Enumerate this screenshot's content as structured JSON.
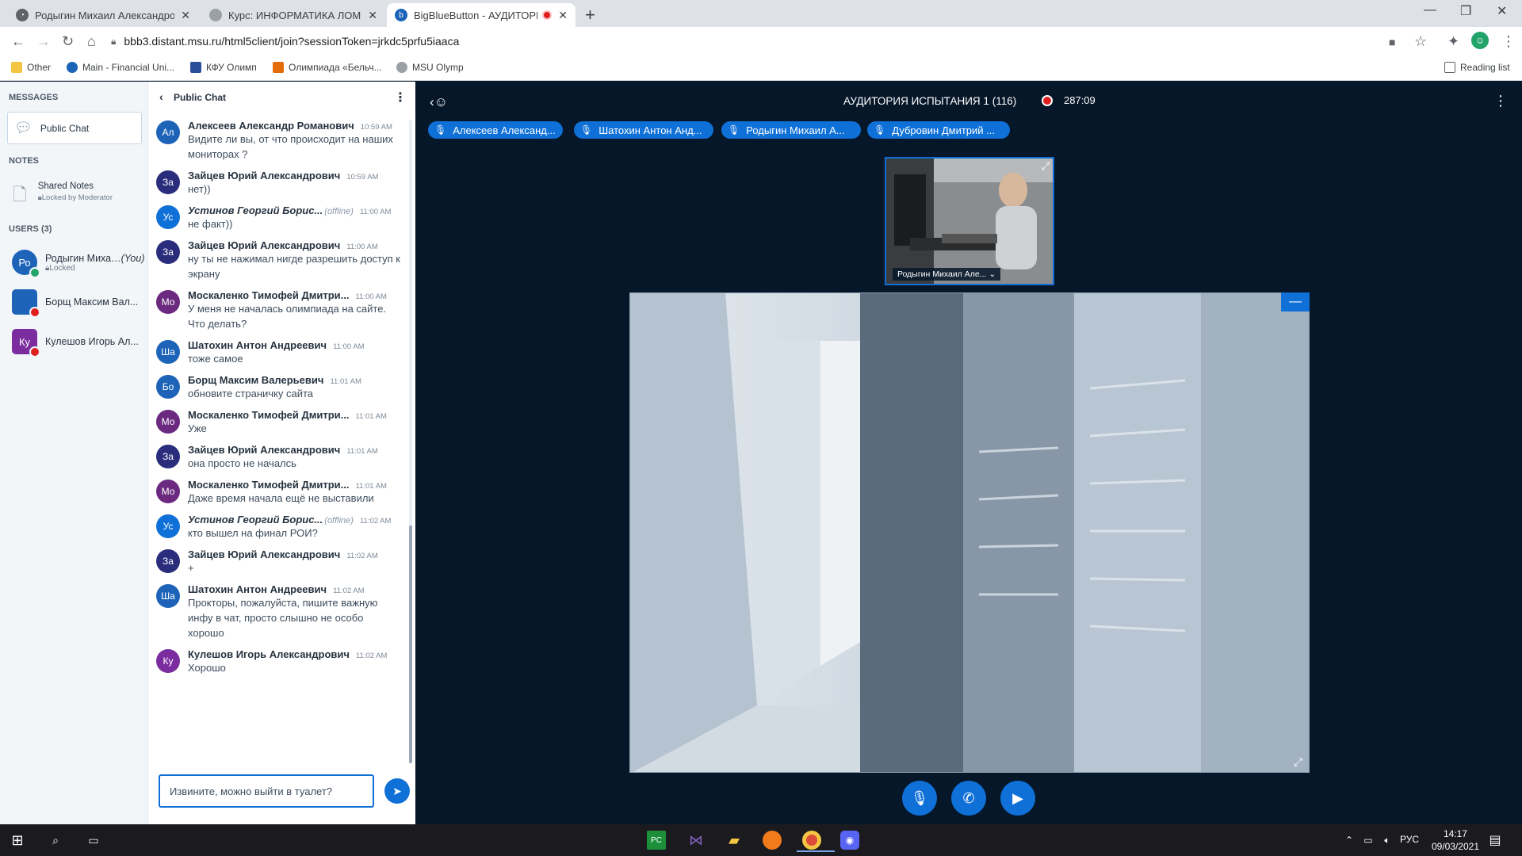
{
  "browser": {
    "tabs": [
      {
        "title": "Родыгин Михаил Александрови",
        "active": false
      },
      {
        "title": "Курс: ИНФОРМАТИКА ЛОМОНО",
        "active": false
      },
      {
        "title": "BigBlueButton - АУДИТОРИ",
        "active": true
      }
    ],
    "url": "bbb3.distant.msu.ru/html5client/join?sessionToken=jrkdc5prfu5iaaca",
    "bookmarks": [
      {
        "label": "Other"
      },
      {
        "label": "Main - Financial Uni..."
      },
      {
        "label": "КФУ Олимп"
      },
      {
        "label": "Олимпиада «Бельч..."
      },
      {
        "label": "MSU Olymp"
      }
    ],
    "reading_list": "Reading list"
  },
  "sidebar": {
    "messages_title": "MESSAGES",
    "public_chat": "Public Chat",
    "notes_title": "NOTES",
    "shared_notes": "Shared Notes",
    "shared_notes_sub": "Locked by Moderator",
    "users_title": "USERS (3)",
    "users": [
      {
        "initials": "Ро",
        "name": "Родыгин Миха…",
        "you": "(You)",
        "sub": "Locked",
        "color": "#1d63b8"
      },
      {
        "initials": "",
        "name": "Борщ Максим Вал...",
        "sub": "",
        "color": "#1d63b8"
      },
      {
        "initials": "Ку",
        "name": "Кулешов Игорь Ал...",
        "sub": "",
        "color": "#7b2c9f"
      }
    ]
  },
  "chat": {
    "title": "Public Chat",
    "messages": [
      {
        "initials": "Ал",
        "color": "#1d63b8",
        "author": "Алексеев Александр Романович",
        "offline": "",
        "time": "10:59 AM",
        "text": "Видите ли вы, от что происходит на наших мониторах ?"
      },
      {
        "initials": "За",
        "color": "#2a2d7c",
        "author": "Зайцев Юрий Александрович",
        "offline": "",
        "time": "10:59 AM",
        "text": "нет))"
      },
      {
        "initials": "Ус",
        "color": "#0f70d7",
        "author": "Устинов Георгий Борис...",
        "offline": "(offline)",
        "time": "11:00 AM",
        "text": "не факт))"
      },
      {
        "initials": "За",
        "color": "#2a2d7c",
        "author": "Зайцев Юрий Александрович",
        "offline": "",
        "time": "11:00 AM",
        "text": "ну ты не нажимал нигде разрешить доступ к экрану"
      },
      {
        "initials": "Мо",
        "color": "#6b2a7f",
        "author": "Москаленко Тимофей Дмитри...",
        "offline": "",
        "time": "11:00 AM",
        "text": "У меня не началась олимпиада на сайте. Что делать?"
      },
      {
        "initials": "Ша",
        "color": "#1d63b8",
        "author": "Шатохин Антон Андреевич",
        "offline": "",
        "time": "11:00 AM",
        "text": "тоже самое"
      },
      {
        "initials": "Бо",
        "color": "#1d63b8",
        "author": "Борщ Максим Валерьевич",
        "offline": "",
        "time": "11:01 AM",
        "text": "обновите страничку сайта"
      },
      {
        "initials": "Мо",
        "color": "#6b2a7f",
        "author": "Москаленко Тимофей Дмитри...",
        "offline": "",
        "time": "11:01 AM",
        "text": "Уже"
      },
      {
        "initials": "За",
        "color": "#2a2d7c",
        "author": "Зайцев Юрий Александрович",
        "offline": "",
        "time": "11:01 AM",
        "text": "она просто не началсь"
      },
      {
        "initials": "Мо",
        "color": "#6b2a7f",
        "author": "Москаленко Тимофей Дмитри...",
        "offline": "",
        "time": "11:01 AM",
        "text": "Даже время начала ещё не выставили"
      },
      {
        "initials": "Ус",
        "color": "#0f70d7",
        "author": "Устинов Георгий Борис...",
        "offline": "(offline)",
        "time": "11:02 AM",
        "text": "кто вышел на финал РОИ?"
      },
      {
        "initials": "За",
        "color": "#2a2d7c",
        "author": "Зайцев Юрий Александрович",
        "offline": "",
        "time": "11:02 AM",
        "text": "+"
      },
      {
        "initials": "Ша",
        "color": "#1d63b8",
        "author": "Шатохин Антон Андреевич",
        "offline": "",
        "time": "11:02 AM",
        "text": "Прокторы, пожалуйста, пишите важную инфу в чат, просто слышно не особо хорошо"
      },
      {
        "initials": "Ку",
        "color": "#7b2c9f",
        "author": "Кулешов Игорь Александрович",
        "offline": "",
        "time": "11:02 AM",
        "text": "Хорошо"
      }
    ],
    "input_value": "Извините, можно выйти в туалет?"
  },
  "meeting": {
    "title": "АУДИТОРИЯ ИСПЫТАНИЯ 1 (116)",
    "recording_time": "287:09",
    "talkers": [
      "Алексеев Александ...",
      "Шатохин Антон Анд...",
      "Родыгин Михаил А...",
      "Дубровин Дмитрий ..."
    ],
    "webcam_label": "Родыгин Михаил Але..."
  },
  "taskbar": {
    "language": "РУС",
    "time": "14:17",
    "date": "09/03/2021"
  },
  "colors": {
    "accent": "#0f70d7",
    "dark_bg": "#06172a",
    "sidebar_bg": "#f3f6f9"
  }
}
